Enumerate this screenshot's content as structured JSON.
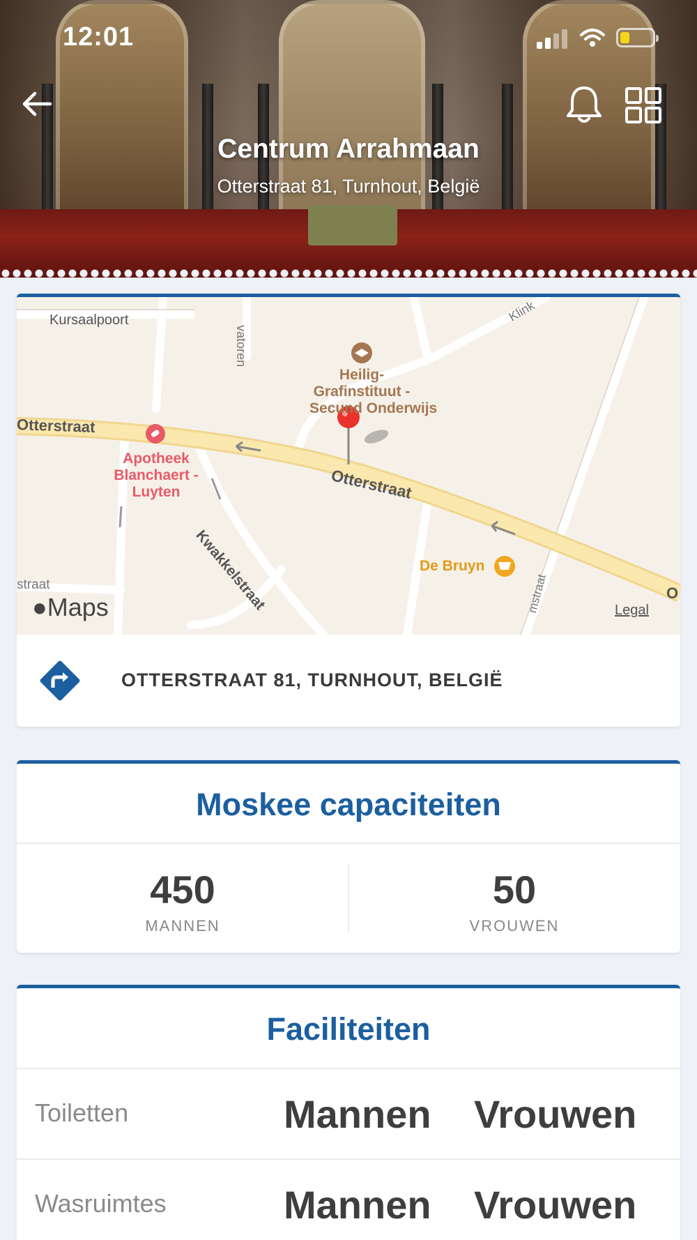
{
  "status_bar": {
    "time": "12:01"
  },
  "header": {
    "title": "Centrum Arrahmaan",
    "subtitle": "Otterstraat 81, Turnhout, België"
  },
  "map": {
    "labels": {
      "kursaalpoort": "Kursaalpoort",
      "vatoren": "vatoren",
      "klink": "Klink",
      "otterstraat_left": "Otterstraat",
      "otterstraat_main": "Otterstraat",
      "otterstraat_right": "O",
      "school_line1": "Heilig-",
      "school_line2": "Grafinstituut -",
      "school_line3": "Secund Onderwijs",
      "pharmacy_line1": "Apotheek",
      "pharmacy_line2": "Blanchaert -",
      "pharmacy_line3": "Luyten",
      "kwakkelstraat": "Kwakkelstraat",
      "de_bruyn": "De Bruyn",
      "straat_left": "straat",
      "straat_bottom": "mstraat",
      "maps_logo": "Maps",
      "legal": "Legal"
    },
    "colors": {
      "road_main": "#fbe5a6",
      "pin": "#e8322b",
      "poi_school": "#a47652",
      "poi_pharmacy": "#e85a68",
      "poi_shop": "#f1a621"
    }
  },
  "location": {
    "address": "OTTERSTRAAT 81, TURNHOUT, BELGIË",
    "icon": "directions-icon"
  },
  "capacity": {
    "title": "Moskee capaciteiten",
    "men": {
      "count": "450",
      "label": "MANNEN"
    },
    "women": {
      "count": "50",
      "label": "VROUWEN"
    }
  },
  "facilities": {
    "title": "Faciliteiten",
    "rows": [
      {
        "label": "Toiletten",
        "men": "Mannen",
        "women": "Vrouwen"
      },
      {
        "label": "Wasruimtes",
        "men": "Mannen",
        "women": "Vrouwen"
      }
    ]
  },
  "theme": {
    "accent": "#1c5fa0",
    "background": "#eef1f6"
  }
}
